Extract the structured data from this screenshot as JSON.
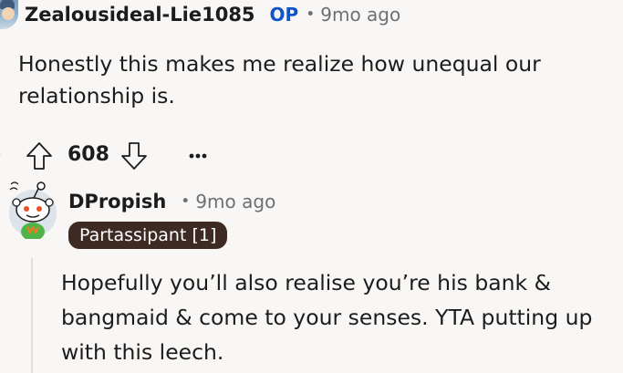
{
  "top_comment": {
    "username": "Zealousideal-Lie1085",
    "op_label": "OP",
    "separator": "•",
    "time": "9mo ago",
    "text": "Honestly this makes me realize how unequal our relationship is.",
    "score": "608"
  },
  "reply": {
    "username": "DPropish",
    "separator": "•",
    "time": "9mo ago",
    "flair": "Partassipant [1]",
    "text": "Hopefully you’ll also realise you’re his bank & bangmaid & come to your senses. YTA putting up with this leech."
  },
  "colors": {
    "op": "#0f55c9",
    "meta": "#6b7075",
    "flair_bg": "#3d2a23",
    "background": "#f9f7f5"
  },
  "icons": {
    "upvote": "arrow-up-icon",
    "downvote": "arrow-down-icon",
    "more": "more-horizontal-icon"
  }
}
